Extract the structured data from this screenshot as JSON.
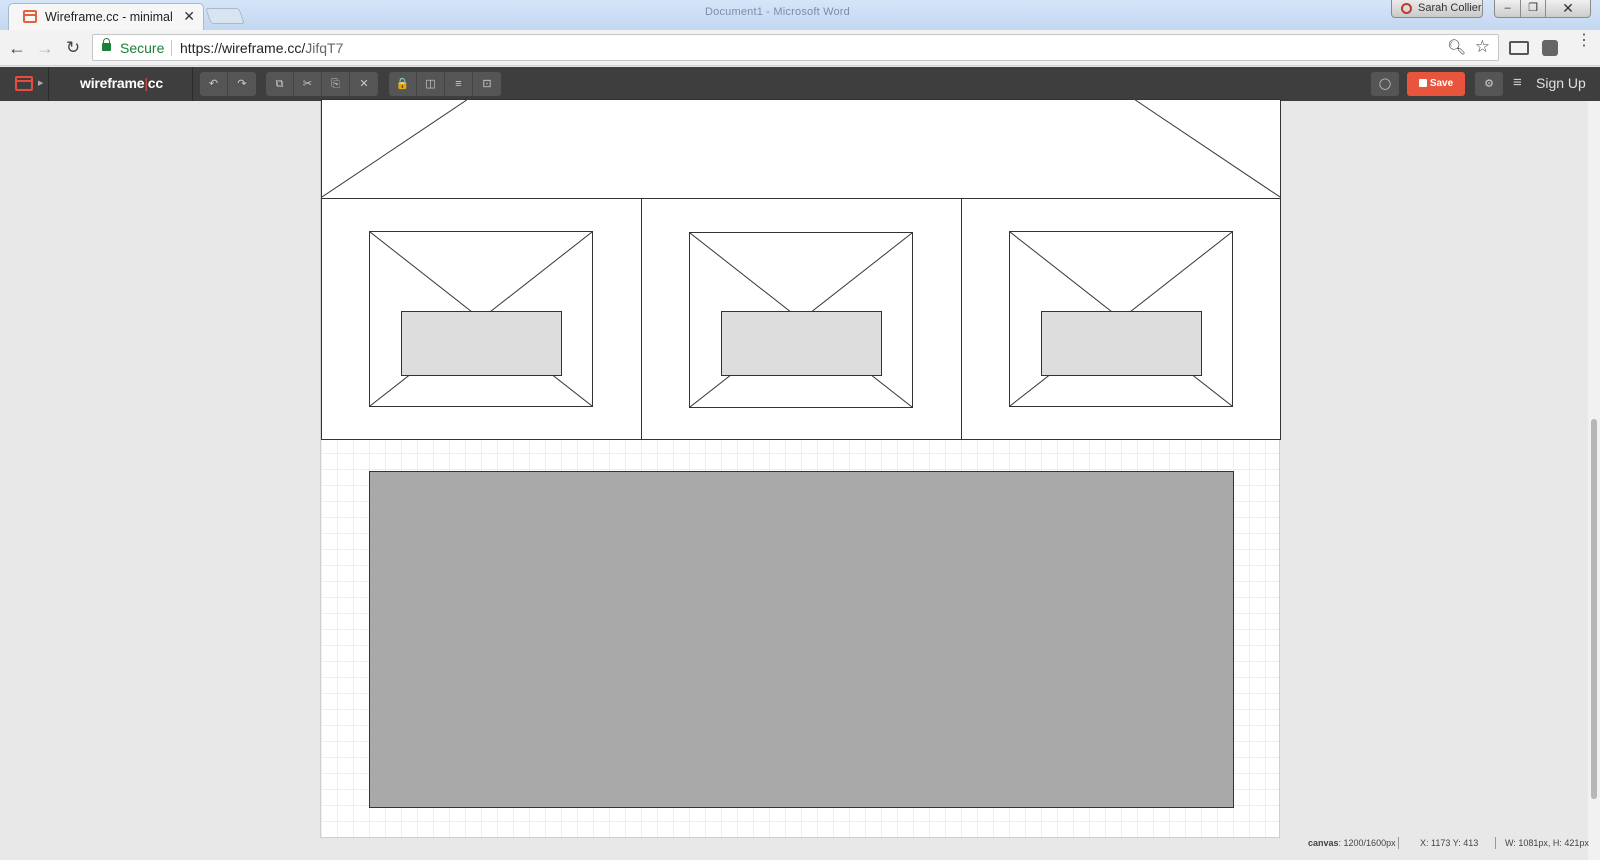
{
  "browser": {
    "tab_title": "Wireframe.cc - minimal w",
    "tab_close": "✕",
    "window_title": "Document1 - Microsoft Word",
    "user_name": "Sarah Collier",
    "minimize": "–",
    "maximize": "❐",
    "close": "✕",
    "secure_label": "Secure",
    "url_base": "https://wireframe.cc/",
    "url_path": "JifqT7",
    "icons": [
      "back-arrow-icon",
      "forward-arrow-icon",
      "reload-icon",
      "lock-icon",
      "zoom-icon",
      "star-icon",
      "cast-icon",
      "extension-icon",
      "menu-icon"
    ]
  },
  "app": {
    "brand_left": "wireframe",
    "brand_bar": "|",
    "brand_right": "cc",
    "toolbar_group1": [
      "↶",
      "↷"
    ],
    "toolbar_group2": [
      "⧉",
      "✂",
      "⎘",
      "✕"
    ],
    "toolbar_group3": [
      "🔒",
      "◫",
      "≡",
      "⊡"
    ],
    "comment_icon": "◯",
    "save_label": "Save",
    "settings_icon": "⚙",
    "menu_icon": "≡",
    "signup_label": "Sign Up",
    "accent": "#e9553c"
  },
  "canvas": {
    "image_placeholder_count": 3,
    "status": {
      "canvas_label": "canvas",
      "canvas_value": ": 1200/1600px",
      "xy": "X: 1173 Y: 413",
      "wh": "W: 1081px, H: 421px"
    }
  }
}
